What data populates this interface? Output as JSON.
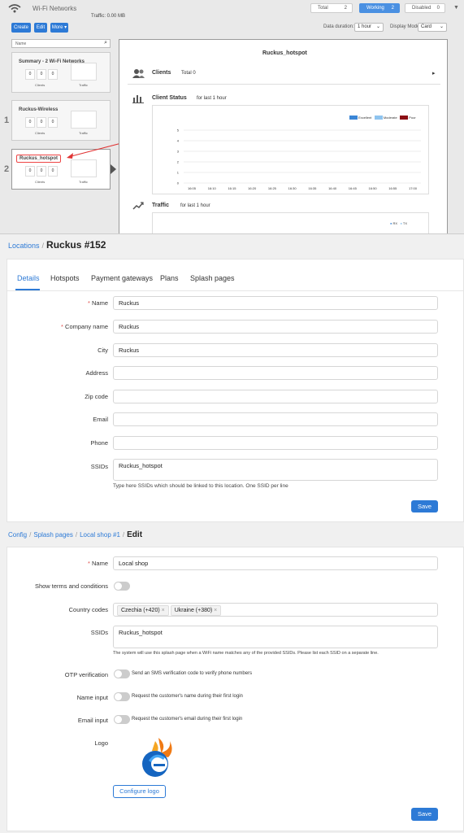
{
  "top": {
    "title": "Wi-Fi Networks",
    "traffic": "Traffic: 0.00 MB",
    "segments": [
      {
        "label": "Total",
        "count": "2"
      },
      {
        "label": "Working",
        "count": "2"
      },
      {
        "label": "Disabled",
        "count": "0"
      }
    ],
    "buttons": {
      "create": "Create",
      "edit": "Edit",
      "more": "More ▾"
    },
    "data_duration_label": "Data duration:",
    "data_duration_value": "1 hour",
    "display_mode_label": "Display Mode:",
    "display_mode_value": "Card",
    "search_placeholder": "Name",
    "cards": [
      {
        "title": "Summary - 2 Wi-Fi Networks",
        "clients": "Clients",
        "traffic": "Traffic",
        "stats": [
          "0",
          "0",
          "0"
        ]
      },
      {
        "title": "Ruckus-Wireless",
        "clients": "Clients",
        "traffic": "Traffic",
        "stats": [
          "0",
          "0",
          "0"
        ],
        "num": "1"
      },
      {
        "title": "Ruckus_hotspot",
        "clients": "Clients",
        "traffic": "Traffic",
        "stats": [
          "0",
          "0",
          "0"
        ],
        "num": "2"
      }
    ],
    "detail": {
      "title": "Ruckus_hotspot",
      "clients_label": "Clients",
      "clients_total": "Total 0",
      "status_label": "Client Status",
      "status_range": "for last 1 hour",
      "traffic_label": "Traffic",
      "traffic_range": "for last 1 hour",
      "legend": [
        {
          "name": "Excellent",
          "color": "#3b86d6"
        },
        {
          "name": "Moderate",
          "color": "#8fc4ef"
        },
        {
          "name": "Poor",
          "color": "#8b0f14"
        }
      ],
      "traffic_legend": [
        "RX",
        "TX"
      ]
    }
  },
  "chart_data": {
    "type": "line",
    "title": "",
    "x": [
      "16:05",
      "16:10",
      "16:15",
      "16:20",
      "16:25",
      "16:30",
      "16:35",
      "16:40",
      "16:45",
      "16:50",
      "16:55",
      "17:00"
    ],
    "series": [],
    "ylim": [
      0,
      5
    ],
    "yticks": [
      "0",
      "1",
      "2",
      "3",
      "4",
      "5"
    ],
    "grid": true,
    "legend": "top-right"
  },
  "locations": {
    "breadcrumb_link": "Locations",
    "breadcrumb_current": "Ruckus #152",
    "tabs": [
      "Details",
      "Hotspots",
      "Payment gateways",
      "Plans",
      "Splash pages"
    ],
    "fields": [
      {
        "label": "Name",
        "value": "Ruckus",
        "required": true
      },
      {
        "label": "Company name",
        "value": "Ruckus",
        "required": true
      },
      {
        "label": "City",
        "value": "Ruckus",
        "required": false
      },
      {
        "label": "Address",
        "value": "",
        "required": false
      },
      {
        "label": "Zip code",
        "value": "",
        "required": false
      },
      {
        "label": "Email",
        "value": "",
        "required": false
      },
      {
        "label": "Phone",
        "value": "",
        "required": false
      }
    ],
    "ssids_label": "SSIDs",
    "ssids_value": "Ruckus_hotspot",
    "ssids_help": "Type here SSIDs which should be linked to this location. One SSID per line",
    "save": "Save"
  },
  "splash": {
    "crumbs": [
      "Config",
      "Splash pages",
      "Local shop #1"
    ],
    "current": "Edit",
    "name_label": "Name",
    "name_value": "Local shop",
    "terms_label": "Show terms and conditions",
    "country_label": "Country codes",
    "countries": [
      "Czechia (+420)",
      "Ukraine (+380)"
    ],
    "ssids_label": "SSIDs",
    "ssids_value": "Ruckus_hotspot",
    "ssids_help": "The system will use this splash page when a WiFi name matches any of the provided SSIDs. Please list each SSID on a separate line.",
    "otp_label": "OTP verification",
    "otp_text": "Send an SMS verification code to verify phone numbers",
    "name_input_label": "Name input",
    "name_input_text": "Request the customer's name during their first login",
    "email_input_label": "Email input",
    "email_input_text": "Request the customer's email during their first login",
    "logo_label": "Logo",
    "configure_logo": "Configure logo",
    "save": "Save"
  }
}
